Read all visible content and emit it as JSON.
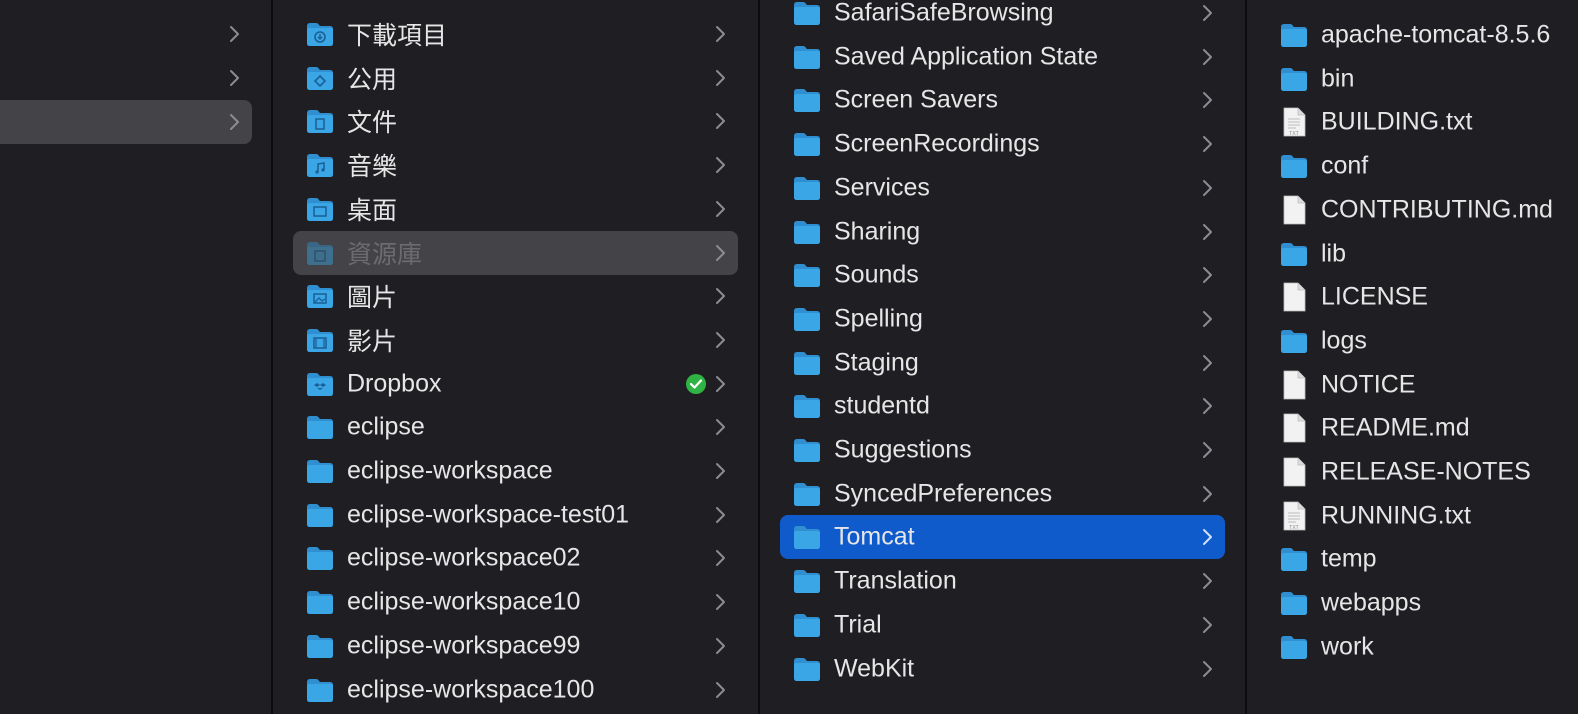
{
  "columns": {
    "col2": {
      "items": [
        {
          "label": "下載項目",
          "icon": "folder-downloads-icon"
        },
        {
          "label": "公用",
          "icon": "folder-public-icon"
        },
        {
          "label": "文件",
          "icon": "folder-documents-icon"
        },
        {
          "label": "音樂",
          "icon": "folder-music-icon"
        },
        {
          "label": "桌面",
          "icon": "folder-desktop-icon"
        },
        {
          "label": "資源庫",
          "icon": "folder-library-icon",
          "state": "selected-inactive"
        },
        {
          "label": "圖片",
          "icon": "folder-pictures-icon"
        },
        {
          "label": "影片",
          "icon": "folder-movies-icon"
        },
        {
          "label": "Dropbox",
          "icon": "folder-dropbox-icon",
          "badge": "synced-check-icon"
        },
        {
          "label": "eclipse",
          "icon": "folder-icon"
        },
        {
          "label": "eclipse-workspace",
          "icon": "folder-icon"
        },
        {
          "label": "eclipse-workspace-test01",
          "icon": "folder-icon"
        },
        {
          "label": "eclipse-workspace02",
          "icon": "folder-icon"
        },
        {
          "label": "eclipse-workspace10",
          "icon": "folder-icon"
        },
        {
          "label": "eclipse-workspace99",
          "icon": "folder-icon"
        },
        {
          "label": "eclipse-workspace100",
          "icon": "folder-icon"
        }
      ]
    },
    "col3": {
      "items": [
        {
          "label": "SafariSafeBrowsing",
          "icon": "folder-icon"
        },
        {
          "label": "Saved Application State",
          "icon": "folder-icon"
        },
        {
          "label": "Screen Savers",
          "icon": "folder-icon"
        },
        {
          "label": "ScreenRecordings",
          "icon": "folder-icon"
        },
        {
          "label": "Services",
          "icon": "folder-icon"
        },
        {
          "label": "Sharing",
          "icon": "folder-icon"
        },
        {
          "label": "Sounds",
          "icon": "folder-icon"
        },
        {
          "label": "Spelling",
          "icon": "folder-icon"
        },
        {
          "label": "Staging",
          "icon": "folder-icon"
        },
        {
          "label": "studentd",
          "icon": "folder-icon"
        },
        {
          "label": "Suggestions",
          "icon": "folder-icon"
        },
        {
          "label": "SyncedPreferences",
          "icon": "folder-icon"
        },
        {
          "label": "Tomcat",
          "icon": "folder-icon",
          "state": "selected-active"
        },
        {
          "label": "Translation",
          "icon": "folder-icon"
        },
        {
          "label": "Trial",
          "icon": "folder-icon"
        },
        {
          "label": "WebKit",
          "icon": "folder-icon"
        }
      ]
    },
    "col4": {
      "items": [
        {
          "label": "apache-tomcat-8.5.6",
          "icon": "folder-icon",
          "kind": "folder"
        },
        {
          "label": "bin",
          "icon": "folder-icon",
          "kind": "folder"
        },
        {
          "label": "BUILDING.txt",
          "icon": "text-file-icon",
          "kind": "txt"
        },
        {
          "label": "conf",
          "icon": "folder-icon",
          "kind": "folder"
        },
        {
          "label": "CONTRIBUTING.md",
          "icon": "document-file-icon",
          "kind": "doc"
        },
        {
          "label": "lib",
          "icon": "folder-icon",
          "kind": "folder"
        },
        {
          "label": "LICENSE",
          "icon": "document-file-icon",
          "kind": "doc"
        },
        {
          "label": "logs",
          "icon": "folder-icon",
          "kind": "folder"
        },
        {
          "label": "NOTICE",
          "icon": "document-file-icon",
          "kind": "doc"
        },
        {
          "label": "README.md",
          "icon": "document-file-icon",
          "kind": "doc"
        },
        {
          "label": "RELEASE-NOTES",
          "icon": "document-file-icon",
          "kind": "doc"
        },
        {
          "label": "RUNNING.txt",
          "icon": "text-file-icon",
          "kind": "txt"
        },
        {
          "label": "temp",
          "icon": "folder-icon",
          "kind": "folder"
        },
        {
          "label": "webapps",
          "icon": "folder-icon",
          "kind": "folder"
        },
        {
          "label": "work",
          "icon": "folder-icon",
          "kind": "folder"
        }
      ]
    }
  },
  "colors": {
    "background": "#1f1e22",
    "selection_active": "#0f5bcc",
    "selection_inactive": "#444347",
    "folder": "#3aa6e6",
    "text": "#e6e6e6"
  }
}
